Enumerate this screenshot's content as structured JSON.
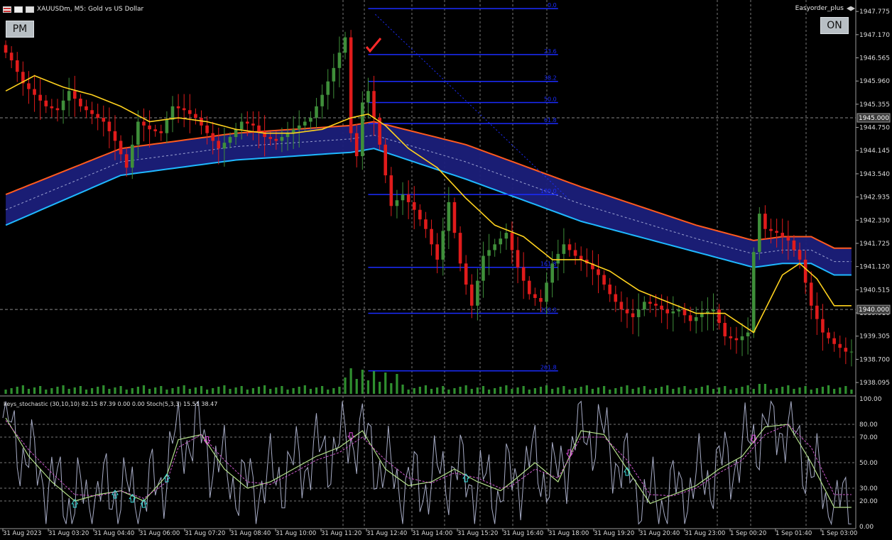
{
  "window": {
    "title": "XAUUSDm, M5:  Gold vs US Dollar",
    "ea_name": "Easyorder_plus"
  },
  "buttons": {
    "pm_label": "PM",
    "on_label": "ON"
  },
  "indicator_label": "keys_stochastic (30,10,10) 82.15 87.39 0.00 0.00 Stoch(5,3,3) 15.51 38.47",
  "colors": {
    "background": "#000000",
    "bull_candle": "#3f8f3a",
    "bear_candle": "#e01b1b",
    "ma_line": "#ffd21e",
    "band_fill": "#1b1f7a",
    "band_upper": "#ff5a1f",
    "band_lower": "#1fb8ff",
    "fib": "#1b2cff",
    "volume": "#2f8f2f"
  },
  "chart_data": {
    "type": "line",
    "symbol": "XAUUSDm",
    "timeframe": "M5",
    "ylim": [
      1937.8,
      1948.0
    ],
    "price_ticks": [
      "1947.775",
      "1947.170",
      "1946.565",
      "1945.960",
      "1945.355",
      "1944.750",
      "1944.145",
      "1943.540",
      "1942.935",
      "1942.330",
      "1941.725",
      "1941.120",
      "1940.515",
      "1939.910",
      "1939.305",
      "1938.700",
      "1938.095"
    ],
    "time_labels": [
      "31 Aug 2023",
      "31 Aug 03:20",
      "31 Aug 04:40",
      "31 Aug 06:00",
      "31 Aug 07:20",
      "31 Aug 08:40",
      "31 Aug 10:00",
      "31 Aug 11:20",
      "31 Aug 12:40",
      "31 Aug 14:00",
      "31 Aug 15:20",
      "31 Aug 16:40",
      "31 Aug 18:00",
      "31 Aug 19:20",
      "31 Aug 20:40",
      "31 Aug 23:00",
      "1 Sep 00:20",
      "1 Sep 01:40",
      "1 Sep 03:00"
    ],
    "crosshair_prices": [
      "1945.000",
      "1940.000"
    ],
    "price_path": [
      [
        0,
        1946.9
      ],
      [
        2,
        1946.5
      ],
      [
        4,
        1945.9
      ],
      [
        6,
        1945.6
      ],
      [
        8,
        1945.3
      ],
      [
        10,
        1945.2
      ],
      [
        12,
        1945.7
      ],
      [
        14,
        1945.3
      ],
      [
        16,
        1945.1
      ],
      [
        18,
        1944.9
      ],
      [
        20,
        1944.4
      ],
      [
        22,
        1943.7
      ],
      [
        24,
        1944.9
      ],
      [
        26,
        1944.7
      ],
      [
        28,
        1944.6
      ],
      [
        30,
        1945.3
      ],
      [
        32,
        1945.2
      ],
      [
        34,
        1945.0
      ],
      [
        36,
        1944.6
      ],
      [
        38,
        1944.2
      ],
      [
        40,
        1944.5
      ],
      [
        42,
        1944.9
      ],
      [
        44,
        1944.8
      ],
      [
        46,
        1944.5
      ],
      [
        48,
        1944.4
      ],
      [
        50,
        1944.6
      ],
      [
        52,
        1944.8
      ],
      [
        54,
        1945.0
      ],
      [
        56,
        1945.6
      ],
      [
        58,
        1946.3
      ],
      [
        60,
        1947.1
      ],
      [
        61,
        1944.6
      ],
      [
        62,
        1944.0
      ],
      [
        63,
        1945.4
      ],
      [
        64,
        1945.7
      ],
      [
        66,
        1944.3
      ],
      [
        68,
        1942.7
      ],
      [
        70,
        1943.0
      ],
      [
        72,
        1942.6
      ],
      [
        74,
        1942.1
      ],
      [
        76,
        1941.3
      ],
      [
        78,
        1942.8
      ],
      [
        80,
        1941.2
      ],
      [
        82,
        1940.1
      ],
      [
        84,
        1941.4
      ],
      [
        86,
        1941.7
      ],
      [
        88,
        1942.0
      ],
      [
        90,
        1941.1
      ],
      [
        92,
        1940.4
      ],
      [
        94,
        1940.2
      ],
      [
        96,
        1941.2
      ],
      [
        98,
        1941.7
      ],
      [
        100,
        1941.4
      ],
      [
        102,
        1941.2
      ],
      [
        104,
        1940.9
      ],
      [
        106,
        1940.4
      ],
      [
        108,
        1940.0
      ],
      [
        110,
        1939.8
      ],
      [
        112,
        1940.2
      ],
      [
        114,
        1940.1
      ],
      [
        116,
        1939.9
      ],
      [
        118,
        1940.0
      ],
      [
        120,
        1939.7
      ],
      [
        122,
        1939.9
      ],
      [
        124,
        1940.0
      ],
      [
        126,
        1939.3
      ],
      [
        128,
        1939.2
      ],
      [
        130,
        1939.4
      ],
      [
        131,
        1941.5
      ],
      [
        132,
        1942.5
      ],
      [
        133,
        1942.1
      ],
      [
        135,
        1942.0
      ],
      [
        137,
        1941.8
      ],
      [
        139,
        1941.3
      ],
      [
        141,
        1940.1
      ],
      [
        143,
        1939.4
      ],
      [
        145,
        1939.1
      ],
      [
        147,
        1938.9
      ]
    ],
    "ma_path": [
      [
        0,
        1945.7
      ],
      [
        5,
        1946.1
      ],
      [
        10,
        1945.8
      ],
      [
        15,
        1945.6
      ],
      [
        20,
        1945.3
      ],
      [
        25,
        1944.9
      ],
      [
        30,
        1945.0
      ],
      [
        35,
        1944.9
      ],
      [
        40,
        1944.7
      ],
      [
        45,
        1944.6
      ],
      [
        50,
        1944.6
      ],
      [
        55,
        1944.7
      ],
      [
        60,
        1945.0
      ],
      [
        63,
        1945.1
      ],
      [
        66,
        1944.8
      ],
      [
        70,
        1944.2
      ],
      [
        75,
        1943.7
      ],
      [
        80,
        1942.9
      ],
      [
        85,
        1942.2
      ],
      [
        90,
        1941.9
      ],
      [
        95,
        1941.3
      ],
      [
        100,
        1941.3
      ],
      [
        105,
        1941.0
      ],
      [
        110,
        1940.5
      ],
      [
        115,
        1940.2
      ],
      [
        120,
        1939.9
      ],
      [
        125,
        1939.9
      ],
      [
        130,
        1939.4
      ],
      [
        135,
        1940.9
      ],
      [
        138,
        1941.2
      ],
      [
        141,
        1940.8
      ],
      [
        144,
        1940.1
      ]
    ],
    "band_upper": [
      [
        0,
        1943.0
      ],
      [
        20,
        1944.2
      ],
      [
        40,
        1944.6
      ],
      [
        60,
        1944.8
      ],
      [
        64,
        1944.9
      ],
      [
        80,
        1944.3
      ],
      [
        100,
        1943.2
      ],
      [
        120,
        1942.2
      ],
      [
        130,
        1941.8
      ],
      [
        135,
        1941.9
      ],
      [
        140,
        1941.9
      ],
      [
        144,
        1941.6
      ]
    ],
    "band_lower": [
      [
        0,
        1942.2
      ],
      [
        20,
        1943.5
      ],
      [
        40,
        1943.9
      ],
      [
        60,
        1944.1
      ],
      [
        64,
        1944.2
      ],
      [
        80,
        1943.4
      ],
      [
        100,
        1942.3
      ],
      [
        120,
        1941.5
      ],
      [
        130,
        1941.1
      ],
      [
        135,
        1941.2
      ],
      [
        140,
        1941.2
      ],
      [
        144,
        1940.9
      ]
    ],
    "fib_levels": [
      {
        "label": "0.0",
        "price": 1947.85
      },
      {
        "label": "23.6",
        "price": 1946.65
      },
      {
        "label": "38.2",
        "price": 1945.95
      },
      {
        "label": "50.0",
        "price": 1945.4
      },
      {
        "label": "61.8",
        "price": 1944.85
      },
      {
        "label": "100.0",
        "price": 1943.0
      },
      {
        "label": "161.8",
        "price": 1941.1
      },
      {
        "label": "200.0",
        "price": 1939.9
      },
      {
        "label": "261.8",
        "price": 1938.4
      }
    ],
    "fib_x_range": [
      63,
      96
    ],
    "stoch_ylim": [
      0,
      100
    ],
    "stoch_ticks": [
      "100.00",
      "80.00",
      "70.00",
      "50.00",
      "30.00",
      "20.00",
      "0.00"
    ],
    "stoch_levels": [
      80,
      70,
      50,
      30,
      20
    ],
    "stoch_slow": [
      [
        0,
        85
      ],
      [
        4,
        55
      ],
      [
        8,
        35
      ],
      [
        12,
        20
      ],
      [
        16,
        25
      ],
      [
        20,
        28
      ],
      [
        24,
        20
      ],
      [
        28,
        40
      ],
      [
        30,
        68
      ],
      [
        34,
        72
      ],
      [
        38,
        45
      ],
      [
        42,
        30
      ],
      [
        46,
        35
      ],
      [
        50,
        45
      ],
      [
        54,
        55
      ],
      [
        58,
        62
      ],
      [
        62,
        75
      ],
      [
        66,
        45
      ],
      [
        70,
        32
      ],
      [
        74,
        35
      ],
      [
        78,
        45
      ],
      [
        82,
        35
      ],
      [
        86,
        28
      ],
      [
        88,
        35
      ],
      [
        92,
        50
      ],
      [
        96,
        35
      ],
      [
        100,
        75
      ],
      [
        104,
        72
      ],
      [
        108,
        45
      ],
      [
        112,
        18
      ],
      [
        116,
        25
      ],
      [
        120,
        32
      ],
      [
        124,
        45
      ],
      [
        128,
        55
      ],
      [
        132,
        78
      ],
      [
        136,
        80
      ],
      [
        140,
        50
      ],
      [
        144,
        15
      ]
    ],
    "stoch_signal": [
      [
        0,
        83
      ],
      [
        4,
        60
      ],
      [
        8,
        42
      ],
      [
        12,
        25
      ],
      [
        16,
        24
      ],
      [
        20,
        28
      ],
      [
        24,
        22
      ],
      [
        28,
        35
      ],
      [
        30,
        62
      ],
      [
        34,
        72
      ],
      [
        38,
        52
      ],
      [
        42,
        35
      ],
      [
        46,
        33
      ],
      [
        50,
        42
      ],
      [
        54,
        52
      ],
      [
        58,
        58
      ],
      [
        62,
        70
      ],
      [
        66,
        52
      ],
      [
        70,
        38
      ],
      [
        74,
        34
      ],
      [
        78,
        42
      ],
      [
        82,
        38
      ],
      [
        86,
        30
      ],
      [
        88,
        32
      ],
      [
        92,
        45
      ],
      [
        96,
        38
      ],
      [
        100,
        70
      ],
      [
        104,
        70
      ],
      [
        108,
        52
      ],
      [
        112,
        25
      ],
      [
        116,
        24
      ],
      [
        120,
        30
      ],
      [
        124,
        42
      ],
      [
        128,
        52
      ],
      [
        132,
        72
      ],
      [
        136,
        80
      ],
      [
        140,
        62
      ],
      [
        144,
        25
      ]
    ]
  }
}
